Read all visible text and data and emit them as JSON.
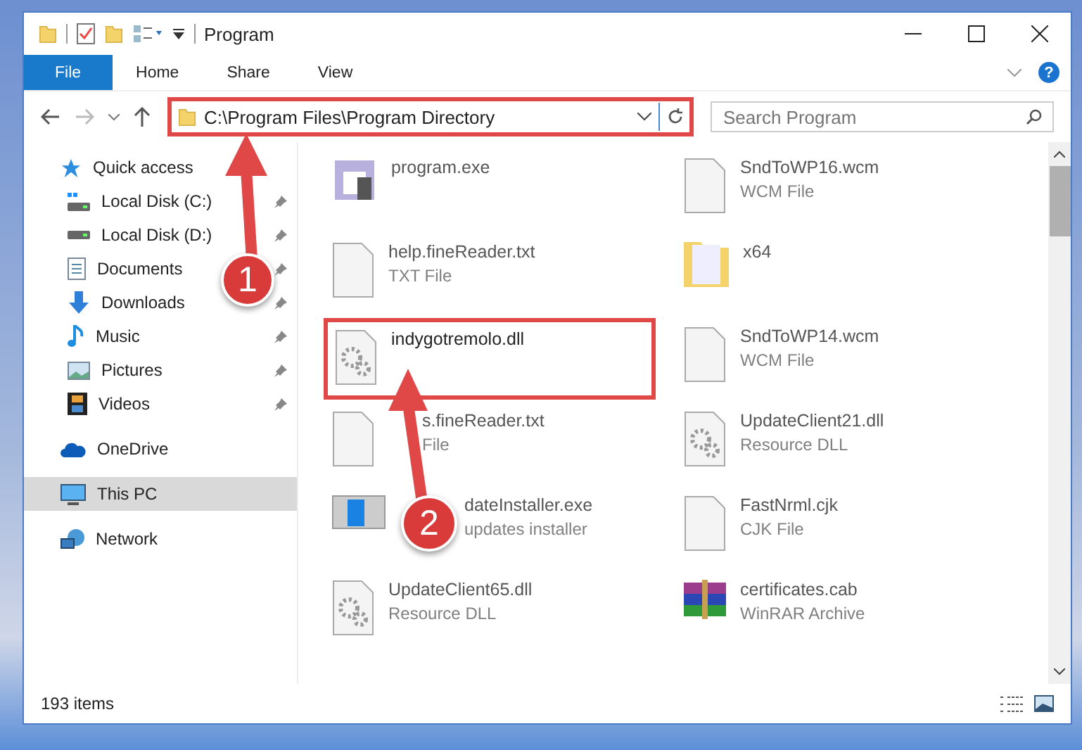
{
  "window": {
    "title": "Program"
  },
  "ribbon_tabs": [
    {
      "label": "File",
      "selected": true
    },
    {
      "label": "Home",
      "selected": false
    },
    {
      "label": "Share",
      "selected": false
    },
    {
      "label": "View",
      "selected": false
    }
  ],
  "help_button": "?",
  "address_bar": {
    "value": "C:\\Program Files\\Program Directory",
    "highlighted": true
  },
  "search": {
    "placeholder": "Search Program"
  },
  "sidebar": {
    "items": [
      {
        "label": "Quick access",
        "kind": "quick",
        "pinned": false,
        "selected": false,
        "children": [
          {
            "label": "Local Disk (C:)",
            "kind": "sysdrive",
            "pinned": true,
            "selected": false
          },
          {
            "label": "Local Disk (D:)",
            "kind": "drive",
            "pinned": true,
            "selected": false
          },
          {
            "label": "Documents",
            "kind": "documents",
            "pinned": true,
            "selected": false
          },
          {
            "label": "Downloads",
            "kind": "downloads",
            "pinned": true,
            "selected": false
          },
          {
            "label": "Music",
            "kind": "music",
            "pinned": true,
            "selected": false
          },
          {
            "label": "Pictures",
            "kind": "pictures",
            "pinned": true,
            "selected": false
          },
          {
            "label": "Videos",
            "kind": "videos",
            "pinned": true,
            "selected": false
          }
        ]
      },
      {
        "label": "OneDrive",
        "kind": "cloud",
        "pinned": false,
        "selected": false
      },
      {
        "label": "This PC",
        "kind": "pc",
        "pinned": false,
        "selected": true
      },
      {
        "label": "Network",
        "kind": "network",
        "pinned": false,
        "selected": false
      }
    ]
  },
  "files": [
    {
      "name": "program.exe",
      "kind": "exe",
      "highlighted": false
    },
    {
      "name": "SndToWP16.wcm",
      "type": "WCM File",
      "kind": "blank",
      "highlighted": false
    },
    {
      "name": "help.fineReader.txt",
      "type": "TXT File",
      "kind": "blank",
      "highlighted": false
    },
    {
      "name": "x64",
      "kind": "folder",
      "highlighted": false
    },
    {
      "name": "indygotremolo.dll",
      "kind": "dll",
      "highlighted": true
    },
    {
      "name": "SndToWP14.wcm",
      "type": "WCM File",
      "kind": "blank",
      "highlighted": false
    },
    {
      "name": "s.fineReader.txt",
      "type": "File",
      "kind": "blank",
      "highlighted": false
    },
    {
      "name": "UpdateClient21.dll",
      "type": "Resource DLL",
      "kind": "dll",
      "highlighted": false
    },
    {
      "name": "dateInstaller.exe",
      "type": "updates installer",
      "kind": "installer",
      "highlighted": false
    },
    {
      "name": "FastNrml.cjk",
      "type": "CJK File",
      "kind": "blank",
      "highlighted": false
    },
    {
      "name": "UpdateClient65.dll",
      "type": "Resource DLL",
      "kind": "dll",
      "highlighted": false
    },
    {
      "name": "certificates.cab",
      "type": "WinRAR Archive",
      "kind": "archive",
      "highlighted": false
    }
  ],
  "callouts": [
    {
      "label": "1"
    },
    {
      "label": "2"
    }
  ],
  "status_bar": {
    "count": "193 items"
  }
}
